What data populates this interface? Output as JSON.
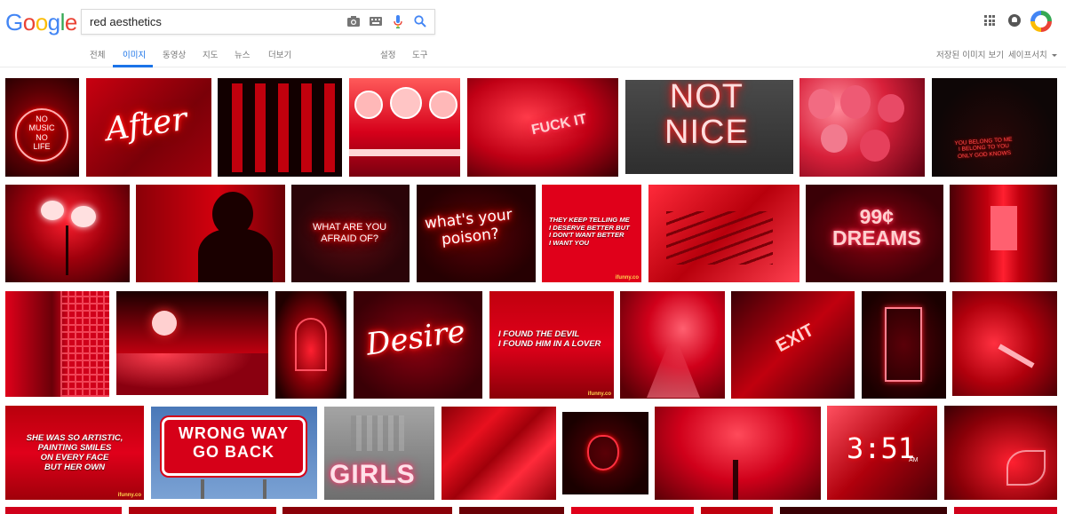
{
  "header": {
    "logo_letters": [
      {
        "char": "G",
        "color": "#4285f4"
      },
      {
        "char": "o",
        "color": "#ea4335"
      },
      {
        "char": "o",
        "color": "#fbbc05"
      },
      {
        "char": "g",
        "color": "#4285f4"
      },
      {
        "char": "l",
        "color": "#34a853"
      },
      {
        "char": "e",
        "color": "#ea4335"
      }
    ],
    "search": {
      "value": "red aesthetics"
    },
    "icons": [
      "camera-icon",
      "keyboard-icon",
      "microphone-icon",
      "search-icon",
      "apps-icon",
      "notifications-icon",
      "account-avatar"
    ]
  },
  "tabs": {
    "all": "전체",
    "images": "이미지",
    "videos": "동영상",
    "maps": "지도",
    "news": "뉴스",
    "more": "더보기",
    "settings": "설정",
    "tools": "도구",
    "saved_images": "저장된 이미지 보기",
    "safe_search": "세이프서치"
  },
  "theme": {
    "accent": "#1a73e8",
    "tab_text": "#777777"
  },
  "captions": {
    "no_music": "NO\nMUSIC\nNO\nLIFE",
    "after": "After",
    "fuck_it": "FUCK IT",
    "not_nice": "NOT\nNICE",
    "belong": "YOU BELONG TO ME\nI BELONG TO YOU\nONLY GOD KNOWS",
    "afraid": "WHAT ARE YOU\nAFRAID OF?",
    "poison": "what's your\npoison?",
    "deserve": "THEY KEEP TELLING ME\nI DESERVE BETTER BUT\nI DON'T WANT BETTER\nI WANT YOU",
    "dreams": "99¢\nDREAMS",
    "desire": "Desire",
    "devil": "I FOUND THE DEVIL\nI FOUND HIM IN A LOVER",
    "exit": "EXIT",
    "artistic": "SHE WAS SO ARTISTIC,\nPAINTING SMILES\nON EVERY FACE\nBUT HER OWN",
    "wrong_way": "WRONG WAY\nGO BACK",
    "girls": "GIRLS",
    "clock": "3:51",
    "clock_am": "AM",
    "watermark": "ifunny.co"
  }
}
